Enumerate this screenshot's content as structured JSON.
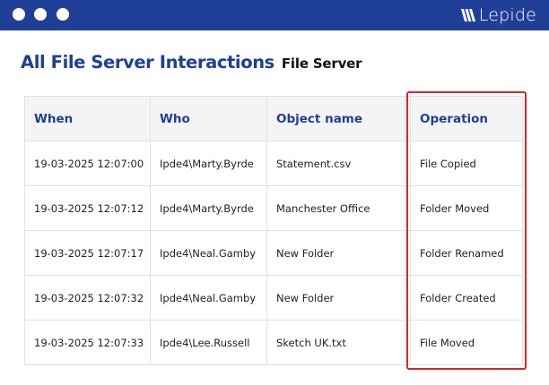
{
  "window": {
    "brand": "Lepide",
    "brand_icon": "lepide-logo-icon",
    "colors": {
      "titlebar": "#1f3f97",
      "accent": "#1f3f97",
      "highlight": "#d9252c"
    }
  },
  "report": {
    "title": "All File Server Interactions",
    "subtitle": "File Server"
  },
  "table": {
    "headers": [
      "When",
      "Who",
      "Object name",
      "Operation"
    ],
    "rows": [
      [
        "19-03-2025 12:07:00",
        "Ipde4\\Marty.Byrde",
        "Statement.csv",
        "File Copied"
      ],
      [
        "19-03-2025 12:07:12",
        "Ipde4\\Marty.Byrde",
        "Manchester Office",
        "Folder Moved"
      ],
      [
        "19-03-2025 12:07:17",
        "Ipde4\\Neal.Gamby",
        "New Folder",
        "Folder Renamed"
      ],
      [
        "19-03-2025 12:07:32",
        "Ipde4\\Neal.Gamby",
        "New Folder",
        "Folder Created"
      ],
      [
        "19-03-2025 12:07:33",
        "Ipde4\\Lee.Russell",
        "Sketch UK.txt",
        "File Moved"
      ]
    ]
  }
}
